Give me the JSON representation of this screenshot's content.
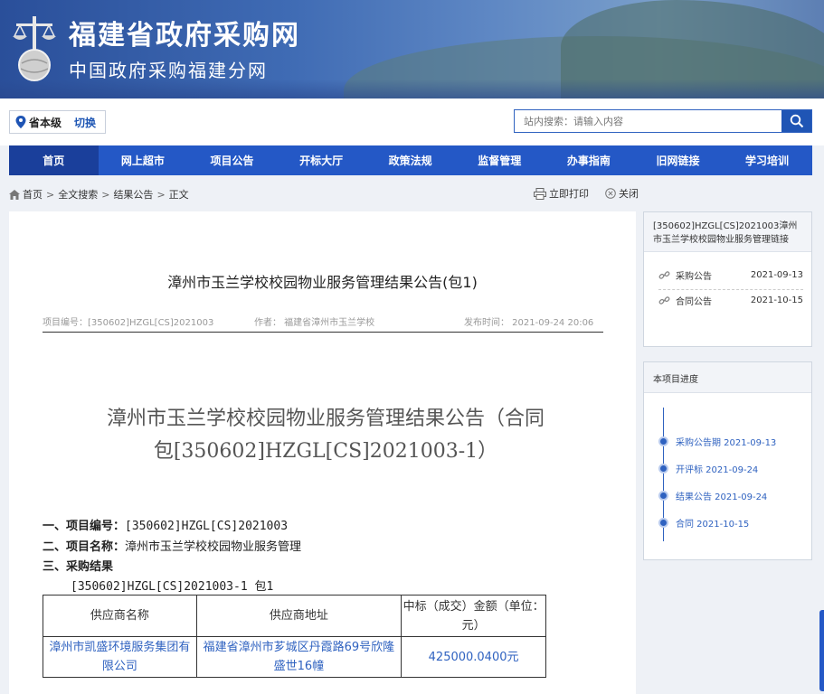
{
  "header": {
    "title": "福建省政府采购网",
    "subtitle": "中国政府采购福建分网"
  },
  "region": {
    "level": "省本级",
    "switch_label": "切换"
  },
  "search": {
    "placeholder": "站内搜索：请输入内容"
  },
  "nav": {
    "items": [
      "首页",
      "网上超市",
      "项目公告",
      "开标大厅",
      "政策法规",
      "监督管理",
      "办事指南",
      "旧网链接",
      "学习培训"
    ],
    "active_index": 0
  },
  "breadcrumb": [
    "首页",
    "全文搜索",
    "结果公告",
    "正文"
  ],
  "tools": {
    "print": "立即打印",
    "close": "关闭"
  },
  "article": {
    "title": "漳州市玉兰学校校园物业服务管理结果公告(包1)",
    "meta": {
      "project_no": "项目编号：[350602]HZGL[CS]2021003",
      "author": "作者：  福建省漳州市玉兰学校",
      "published": "发布时间：  2021-09-24 20:06"
    },
    "big_title_line1": "漳州市玉兰学校校园物业服务管理结果公告（合同",
    "big_title_line2": "包[350602]HZGL[CS]2021003-1）",
    "s1_label": "一、项目编号：",
    "s1_value": "[350602]HZGL[CS]2021003",
    "s2_label": "二、项目名称：",
    "s2_value": "漳州市玉兰学校校园物业服务管理",
    "s3_label": "三、采购结果",
    "package_line": "[350602]HZGL[CS]2021003-1 包1",
    "table": {
      "headers": [
        "供应商名称",
        "供应商地址",
        "中标（成交）金额（单位：元）"
      ],
      "rows": [
        [
          "漳州市凯盛环境服务集团有限公司",
          "福建省漳州市芗城区丹霞路69号欣隆盛世16幢",
          "425000.0400元"
        ]
      ]
    }
  },
  "links_panel": {
    "title": "[350602]HZGL[CS]2021003漳州市玉兰学校校园物业服务管理链接",
    "items": [
      {
        "label": "采购公告",
        "date": "2021-09-13"
      },
      {
        "label": "合同公告",
        "date": "2021-10-15"
      }
    ]
  },
  "progress_panel": {
    "title": "本项目进度",
    "steps": [
      "采购公告期 2021-09-13",
      "开评标 2021-09-24",
      "结果公告 2021-09-24",
      "合同 2021-10-15"
    ]
  },
  "colors": {
    "nav": "#2458c6",
    "nav_active": "#1a3f9b",
    "link": "#2f62c0"
  }
}
